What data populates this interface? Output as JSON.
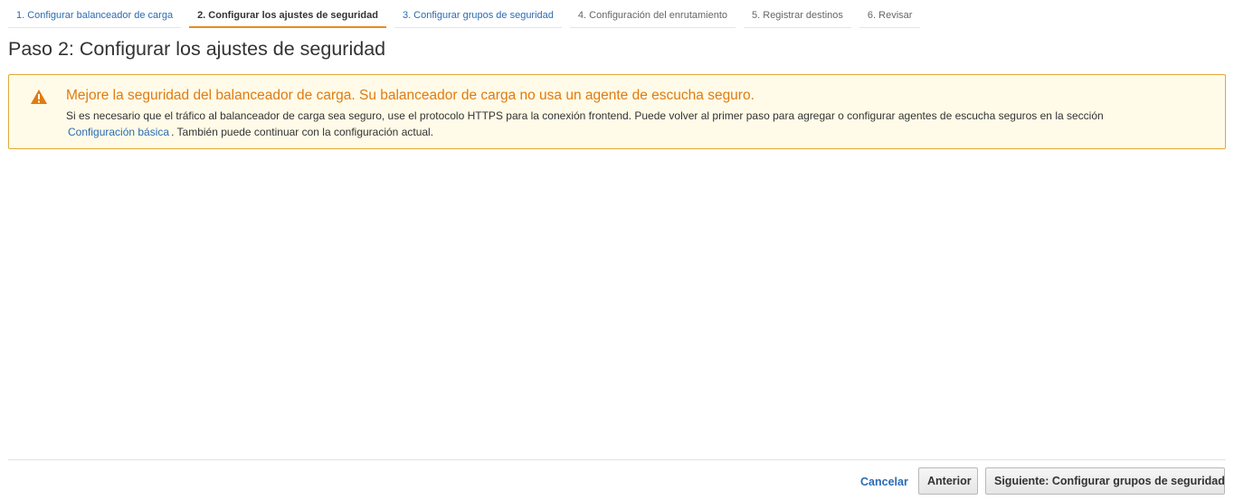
{
  "wizard": {
    "steps": [
      {
        "label": "1. Configurar balanceador de carga"
      },
      {
        "label": "2. Configurar los ajustes de seguridad"
      },
      {
        "label": "3. Configurar grupos de seguridad"
      },
      {
        "label": "4. Configuración del enrutamiento"
      },
      {
        "label": "5. Registrar destinos"
      },
      {
        "label": "6. Revisar"
      }
    ],
    "active_step": 2
  },
  "page": {
    "title": "Paso 2: Configurar los ajustes de seguridad"
  },
  "alert": {
    "icon": "warning-icon",
    "title": "Mejore la seguridad del balanceador de carga. Su balanceador de carga no usa un agente de escucha seguro.",
    "body_before": "Si es necesario que el tráfico al balanceador de carga sea seguro, use el protocolo HTTPS para la conexión frontend. Puede volver al primer paso para agregar o configurar agentes de escucha seguros en la sección",
    "link": "Configuración básica",
    "body_after": ". También puede continuar con la configuración actual.",
    "colors": {
      "title": "#e07b0f",
      "background": "#fffbe8",
      "border": "#e0a83a"
    }
  },
  "footer": {
    "cancel_label": "Cancelar",
    "previous_label": "Anterior",
    "next_label": "Siguiente: Configurar grupos de seguridad"
  },
  "colors": {
    "link": "#2a6bb3",
    "active_tab_underline": "#e88b1c"
  }
}
